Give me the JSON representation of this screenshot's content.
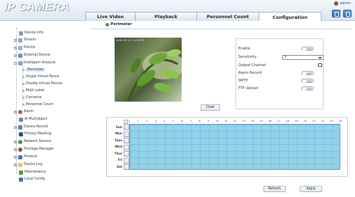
{
  "app": {
    "logo": "IP CAMERA",
    "user": "admin"
  },
  "tabs": [
    {
      "label": "Live Video",
      "active": false
    },
    {
      "label": "Playback",
      "active": false
    },
    {
      "label": "Personnel Count",
      "active": false
    },
    {
      "label": "Configuration",
      "active": true
    }
  ],
  "sidebar": {
    "items": [
      {
        "label": "Device Info",
        "icon": "doc-icon",
        "expander": ""
      },
      {
        "label": "Stream",
        "icon": "stream-icon",
        "expander": "+"
      },
      {
        "label": "Device",
        "icon": "device-icon",
        "expander": "+"
      },
      {
        "label": "External Device",
        "icon": "external-device-icon",
        "expander": "+"
      },
      {
        "label": "Intelligent Analysis",
        "icon": "analysis-icon",
        "expander": "-"
      },
      {
        "label": "Perimeter",
        "icon": "leaf",
        "expander": "",
        "selected": true
      },
      {
        "label": "Single Virtual Fence",
        "icon": "leaf",
        "expander": ""
      },
      {
        "label": "Double Virtual Fences",
        "icon": "leaf",
        "expander": ""
      },
      {
        "label": "Multi Loiter",
        "icon": "leaf",
        "expander": ""
      },
      {
        "label": "Converse",
        "icon": "leaf",
        "expander": ""
      },
      {
        "label": "Personnel Count",
        "icon": "leaf",
        "expander": ""
      },
      {
        "label": "Alarm",
        "icon": "alarm-icon",
        "expander": "+"
      },
      {
        "label": "AI Multiobject",
        "icon": "ai-icon",
        "expander": ""
      },
      {
        "label": "Device Record",
        "icon": "record-icon",
        "expander": "+"
      },
      {
        "label": "Privacy Masking",
        "icon": "mask-icon",
        "expander": ""
      },
      {
        "label": "Network Service",
        "icon": "network-icon",
        "expander": "+"
      },
      {
        "label": "Privilege Manager",
        "icon": "users-icon",
        "expander": "+"
      },
      {
        "label": "Protocol",
        "icon": "protocol-icon",
        "expander": "+"
      },
      {
        "label": "Device Log",
        "icon": "log-icon",
        "expander": "+"
      },
      {
        "label": "Maintenance",
        "icon": "maintenance-icon",
        "expander": ""
      },
      {
        "label": "Local Config",
        "icon": "local-config-icon",
        "expander": ""
      }
    ]
  },
  "main": {
    "title": "Perimeter",
    "video_osd": "2016-07-11 11:19:53",
    "clear_label": "Clear",
    "settings": {
      "enable_label": "Enable",
      "enable_state": "OFF",
      "sensitivity_label": "Sensitivity",
      "sensitivity_value": "5",
      "output_channel_label": "Output Channel",
      "alarm_record_label": "Alarm Record",
      "alarm_record_state": "OFF",
      "smtp_label": "SMTP",
      "smtp_state": "OFF",
      "ftp_upload_label": "FTP Upload",
      "ftp_upload_state": "OFF"
    },
    "schedule": {
      "hours": [
        "0",
        "1",
        "2",
        "3",
        "4",
        "5",
        "6",
        "7",
        "8",
        "9",
        "10",
        "11",
        "12",
        "13",
        "14",
        "15",
        "16",
        "17",
        "18",
        "19",
        "20",
        "21",
        "22",
        "23",
        "24"
      ],
      "days": [
        "Sun",
        "Mon",
        "Tues",
        "Wed",
        "Thur",
        "Fri",
        "Sat"
      ]
    },
    "refresh_label": "Refresh",
    "apply_label": "Apply"
  },
  "colors": {
    "grid_fill": "#93d3ea",
    "grid_line": "#468cbe",
    "header_bg": "#dfe7f1"
  }
}
